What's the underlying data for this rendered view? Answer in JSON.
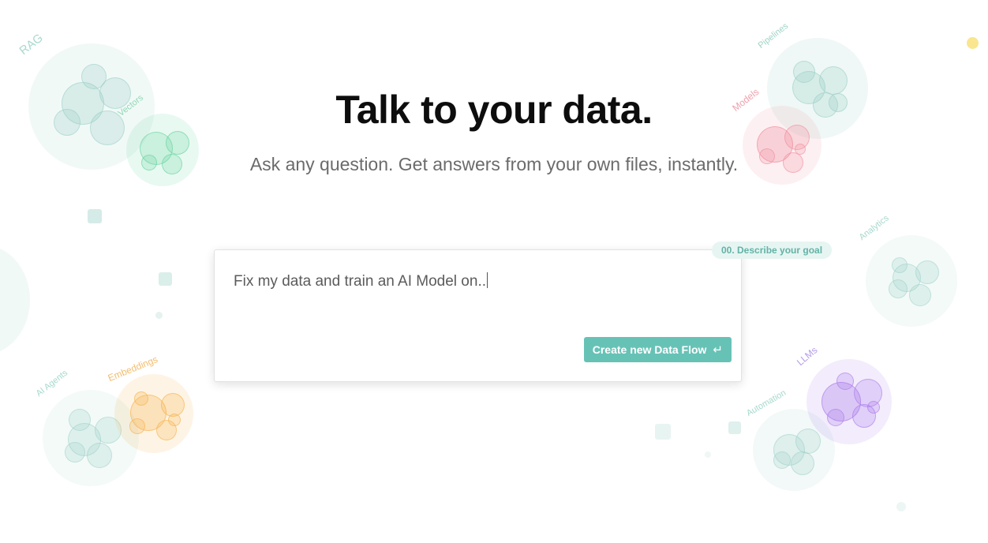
{
  "hero": {
    "title": "Talk to your data.",
    "subtitle": "Ask any question. Get answers from your own files, instantly."
  },
  "prompt": {
    "value": "Fix my data and train an AI Model on..",
    "step_label": "00. Describe your goal",
    "submit_label": "Create new Data Flow",
    "submit_icon": "enter-icon"
  },
  "topics": {
    "rag": "RAG",
    "vectors": "Vectors",
    "pipelines": "Pipelines",
    "models": "Models",
    "analytics": "Analytics",
    "ai_agents": "AI Agents",
    "embeddings": "Embeddings",
    "automation": "Automation",
    "llms": "LLMs"
  },
  "colors": {
    "accent": "#67c2b6",
    "teal_bubble": "#a9d9cf",
    "green_bubble": "#5fd29a",
    "red_bubble": "#f08a9b",
    "orange_bubble": "#f6b34e",
    "purple_bubble": "#a879ea",
    "yellow_dot": "#f8e27a"
  }
}
